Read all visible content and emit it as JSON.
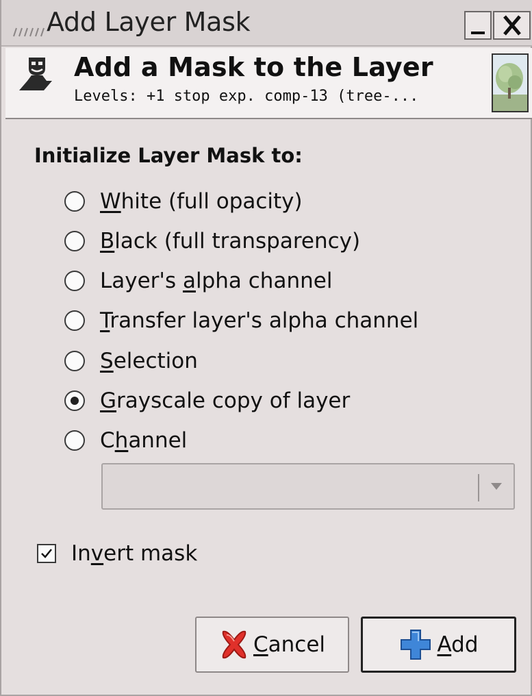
{
  "window": {
    "title": "Add Layer Mask",
    "minimize_label": "_",
    "close_label": "X"
  },
  "header": {
    "title": "Add a Mask to the Layer",
    "subtitle": "Levels: +1 stop exp. comp-13 (tree-...",
    "icon": "gimp-wilber-icon",
    "thumbnail": "layer-thumbnail-tree"
  },
  "section": {
    "title": "Initialize Layer Mask to:"
  },
  "options": [
    {
      "pre": "",
      "key": "W",
      "post": "hite (full opacity)",
      "checked": false
    },
    {
      "pre": "",
      "key": "B",
      "post": "lack (full transparency)",
      "checked": false
    },
    {
      "pre": "Layer's ",
      "key": "a",
      "post": "lpha channel",
      "checked": false
    },
    {
      "pre": "",
      "key": "T",
      "post": "ransfer layer's alpha channel",
      "checked": false
    },
    {
      "pre": "",
      "key": "S",
      "post": "election",
      "checked": false
    },
    {
      "pre": "",
      "key": "G",
      "post": "rayscale copy of layer",
      "checked": true
    },
    {
      "pre": "C",
      "key": "h",
      "post": "annel",
      "checked": false
    }
  ],
  "channel_combo": {
    "value": "",
    "icon": "chevron-down-icon"
  },
  "invert": {
    "pre": "In",
    "key": "v",
    "post": "ert mask",
    "checked": true
  },
  "buttons": {
    "cancel": {
      "key": "C",
      "post": "ancel",
      "icon": "cancel-x-icon"
    },
    "add": {
      "key": "A",
      "post": "dd",
      "icon": "plus-icon"
    }
  },
  "colors": {
    "background": "#e5dfdf",
    "header_bg": "#f4f1f1",
    "cancel_icon": "#e0302a",
    "add_icon": "#3f86d8"
  }
}
